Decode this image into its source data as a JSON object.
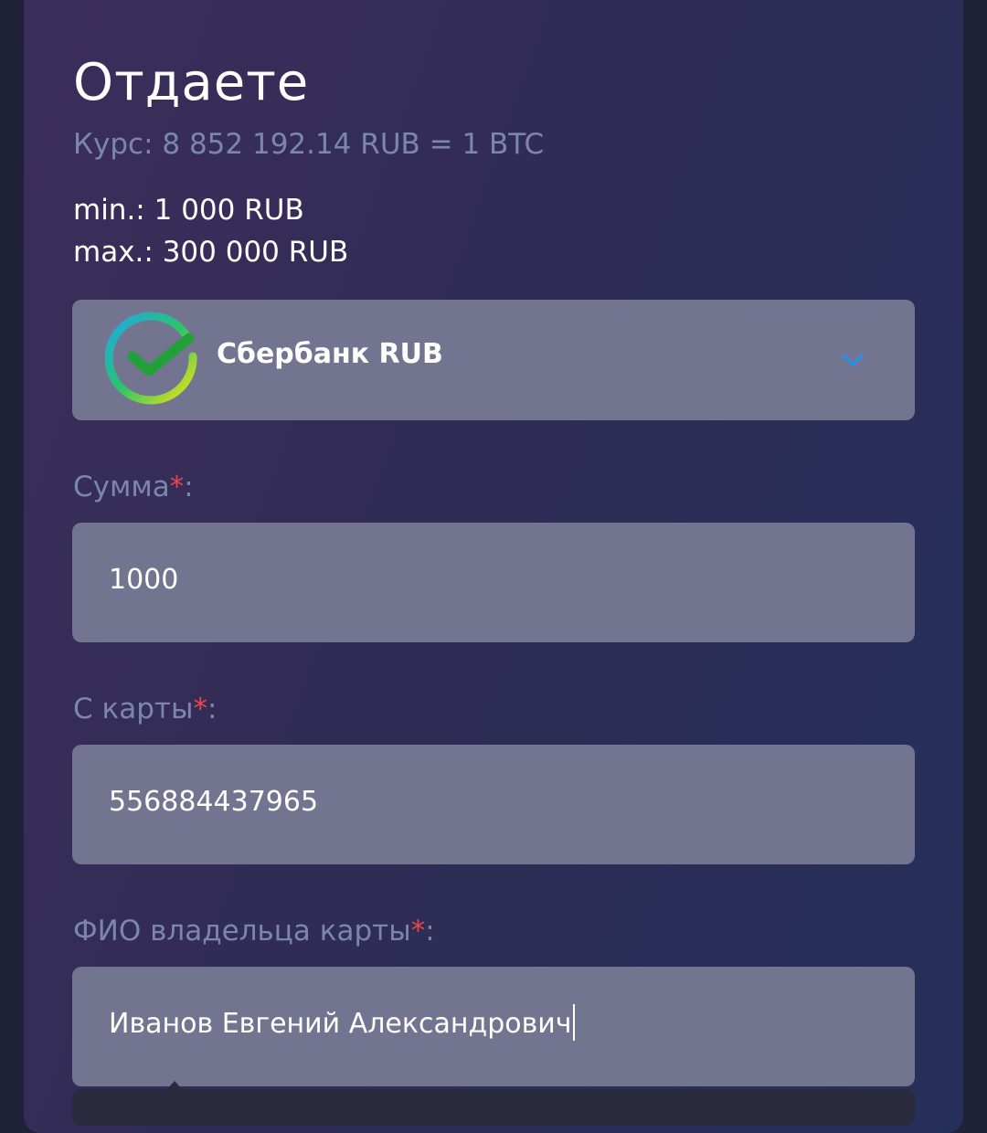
{
  "section": {
    "title": "Отдаете",
    "rate": "Курс: 8 852 192.14 RUB = 1 BTC",
    "min": "min.: 1 000 RUB",
    "max": "max.: 300 000 RUB"
  },
  "payment_method": {
    "selected": "Сбербанк RUB",
    "icon": "sberbank-logo-icon",
    "colors": {
      "ring_start": "#1ea8e6",
      "ring_mid": "#2bc46a",
      "ring_end": "#f2e40f",
      "check": "#21a038",
      "chevron": "#2b8fe6"
    }
  },
  "form": {
    "amount": {
      "label": "Сумма",
      "required_mark": "*",
      "suffix": ":",
      "value": "1000"
    },
    "card": {
      "label": "С карты",
      "required_mark": "*",
      "suffix": ":",
      "value": "556884437965"
    },
    "holder": {
      "label": "ФИО владельца карты",
      "required_mark": "*",
      "suffix": ":",
      "value": "Иванов Евгений Александрович"
    }
  }
}
